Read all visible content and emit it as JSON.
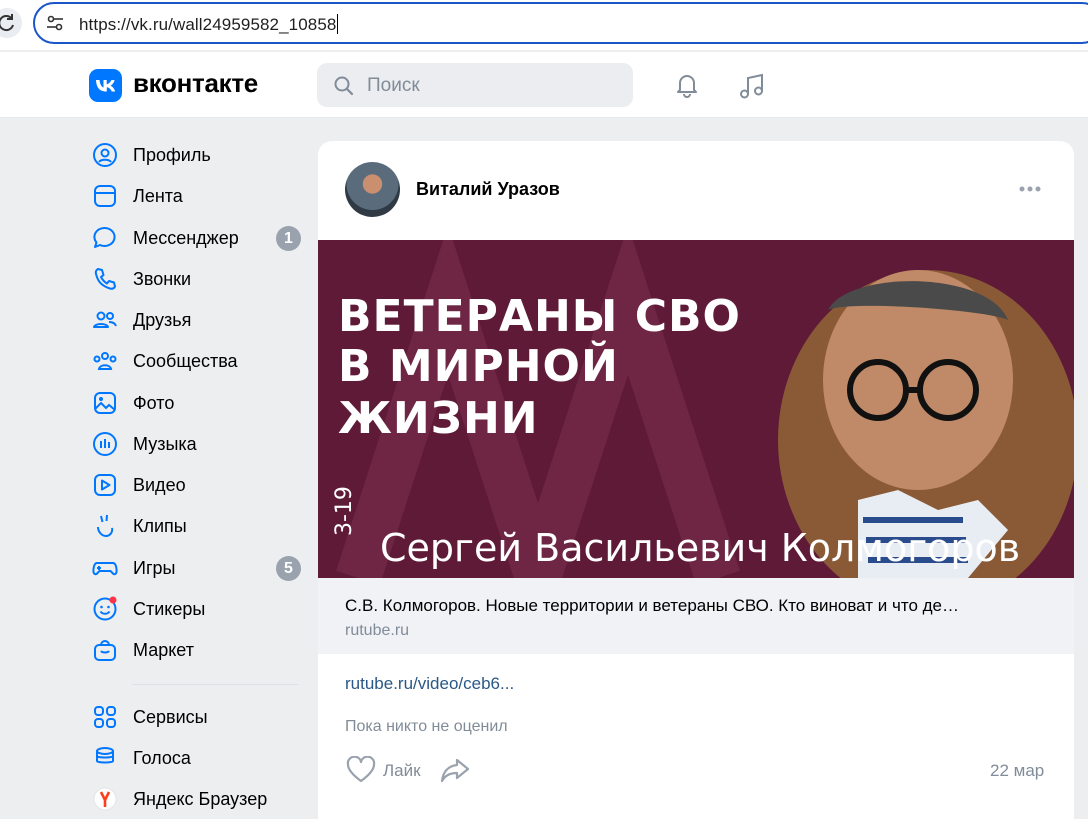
{
  "browser": {
    "url": "https://vk.ru/wall24959582_10858"
  },
  "header": {
    "logo_text": "вконтакте",
    "search_placeholder": "Поиск"
  },
  "sidebar": {
    "items": [
      {
        "label": "Профиль",
        "icon": "profile-icon"
      },
      {
        "label": "Лента",
        "icon": "feed-icon"
      },
      {
        "label": "Мессенджер",
        "icon": "messenger-icon",
        "badge": "1"
      },
      {
        "label": "Звонки",
        "icon": "phone-icon"
      },
      {
        "label": "Друзья",
        "icon": "friends-icon"
      },
      {
        "label": "Сообщества",
        "icon": "communities-icon"
      },
      {
        "label": "Фото",
        "icon": "photo-icon"
      },
      {
        "label": "Музыка",
        "icon": "music-icon"
      },
      {
        "label": "Видео",
        "icon": "video-icon"
      },
      {
        "label": "Клипы",
        "icon": "clips-icon"
      },
      {
        "label": "Игры",
        "icon": "games-icon",
        "badge": "5"
      },
      {
        "label": "Стикеры",
        "icon": "stickers-icon"
      },
      {
        "label": "Маркет",
        "icon": "market-icon"
      },
      {
        "label": "Сервисы",
        "icon": "services-icon"
      },
      {
        "label": "Голоса",
        "icon": "votes-icon"
      },
      {
        "label": "Яндекс Браузер",
        "icon": "yandex-icon"
      }
    ]
  },
  "post": {
    "author": "Виталий Уразов",
    "banner": {
      "line1": "ВЕТЕРАНЫ СВО",
      "line2": "В МИРНОЙ",
      "line3": "ЖИЗНИ",
      "subtitle": "Сергей Васильевич Колмогоров",
      "side_text": "3-19"
    },
    "link_title": "С.В. Колмогоров. Новые территории и ветераны СВО. Кто виноват и что де…",
    "link_domain": "rutube.ru",
    "url_text": "rutube.ru/video/ceb6...",
    "likes_text": "Пока никто не оценил",
    "like_label": "Лайк",
    "date": "22 мар"
  },
  "colors": {
    "accent": "#0077ff",
    "banner": "#5e1a36",
    "link": "#2a5885",
    "muted": "#818c99"
  }
}
